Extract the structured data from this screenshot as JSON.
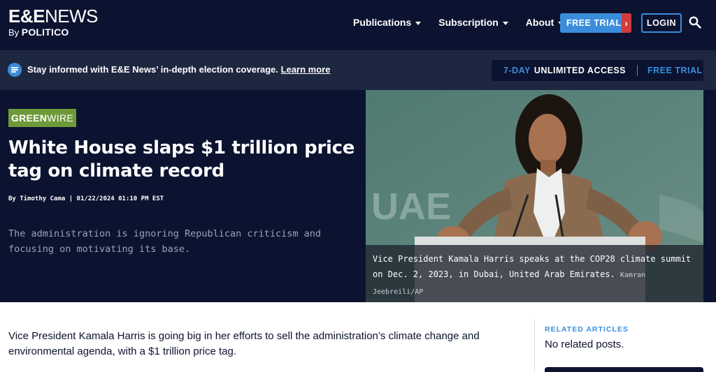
{
  "header": {
    "logo_main_ee": "E&E",
    "logo_main_news": "NEWS",
    "logo_sub_by": "By",
    "logo_sub_politico": "POLITICO",
    "nav": [
      {
        "label": "Publications"
      },
      {
        "label": "Subscription"
      },
      {
        "label": "About"
      }
    ],
    "free_trial_label": "FREE TRIAL",
    "free_trial_arrow": "›",
    "login_label": "LOGIN",
    "search_icon": "search-icon"
  },
  "banner": {
    "text": "Stay informed with E&E News’ in-depth election coverage.",
    "link": "Learn more",
    "access_seven": "7-DAY",
    "access_unlimited": "UNLIMITED ACCESS",
    "access_trial": "FREE TRIAL"
  },
  "hero": {
    "section_green": "GREEN",
    "section_wire": "WIRE",
    "headline": "White House slaps $1 trillion price tag on climate record",
    "byline": "By Timothy Cama | 01/22/2024 01:10 PM EST",
    "dek": "The administration is ignoring Republican criticism and focusing on motivating its base.",
    "caption": "Vice President Kamala Harris speaks at the COP28 climate summit on Dec. 2, 2023, in Dubai, United Arab Emirates.",
    "credit": "Kamran Jeebreili/AP",
    "photo_bg_text": "UAE"
  },
  "article": {
    "lead": "Vice President Kamala Harris is going big in her efforts to sell the administration’s climate change and environmental agenda, with a $1 trillion price tag."
  },
  "related": {
    "title": "RELATED ARTICLES",
    "empty": "No related posts."
  },
  "colors": {
    "navy": "#0b1330",
    "banner": "#1e2740",
    "accent_blue": "#3b8ddb",
    "arrow_red": "#d23c3c",
    "greenwire": "#6f9a3a"
  }
}
